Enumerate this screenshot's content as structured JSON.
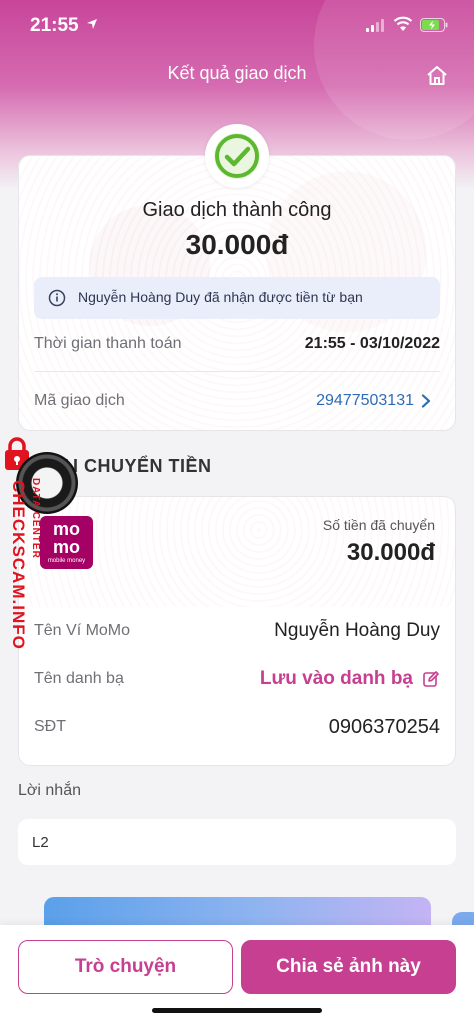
{
  "status_bar": {
    "time": "21:55"
  },
  "header": {
    "title": "Kết quả giao dịch",
    "home_icon": "home-icon"
  },
  "result": {
    "title": "Giao dịch thành công",
    "amount": "30.000đ",
    "info": "Nguyễn Hoàng Duy đã nhận được tiền từ bạn",
    "payment_time_label": "Thời gian thanh toán",
    "payment_time_value": "21:55 - 03/10/2022",
    "txn_id_label": "Mã giao dịch",
    "txn_id_value": "29477503131"
  },
  "section": {
    "title": "LAI CHUYỂN TIỀN"
  },
  "transfer": {
    "logo_line1": "mo",
    "logo_line2": "mo",
    "logo_tagline": "mobile money",
    "sent_label": "Số tiền đã chuyển",
    "sent_amount": "30.000đ",
    "wallet_name_label": "Tên Ví MoMo",
    "wallet_name_value": "Nguyễn Hoàng Duy",
    "contact_label": "Tên danh bạ",
    "contact_value": "Lưu vào danh bạ",
    "phone_label": "SĐT",
    "phone_value": "0906370254"
  },
  "message": {
    "label": "Lời nhắn",
    "value": "L2"
  },
  "actions": {
    "chat_label": "Trò chuyện",
    "share_label": "Chia sẻ ảnh này"
  },
  "watermark": {
    "side_text": "CHECKSCAM.INFO",
    "small_text": "DATA CENTER"
  },
  "colors": {
    "brand_pink": "#c63f91",
    "success_green": "#5cb82e",
    "link_blue": "#2d6cb5"
  }
}
